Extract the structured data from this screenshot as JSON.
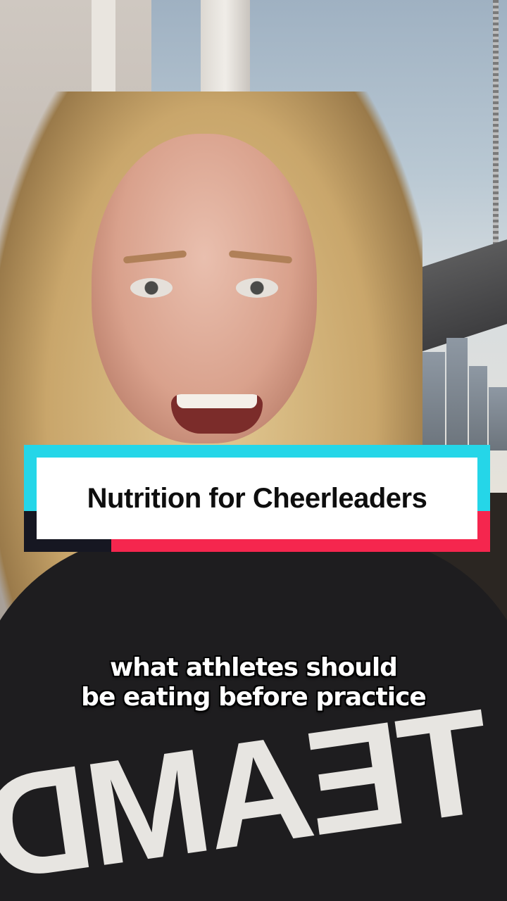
{
  "title_banner": {
    "text": "Nutrition for Cheerleaders"
  },
  "caption": {
    "line1": "what athletes should",
    "line2": "be eating before practice"
  },
  "shirt_print": {
    "text": "TEAMDV"
  },
  "colors": {
    "banner_cyan": "#25d6e8",
    "banner_red": "#f5264e",
    "banner_dark": "#161722",
    "caption_text": "#ffffff"
  }
}
